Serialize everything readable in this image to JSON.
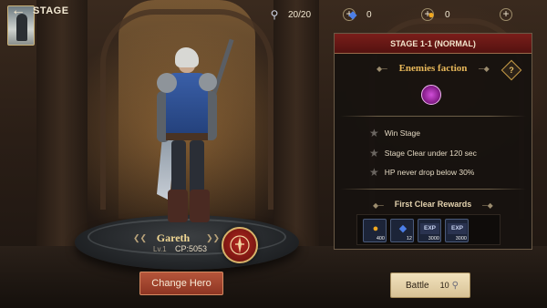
{
  "header": {
    "title": "STAGE",
    "back_icon": "back-arrow-icon"
  },
  "resources": [
    {
      "icon": "key-icon",
      "value": "20/20"
    },
    {
      "icon": "gem-icon",
      "value": "0"
    },
    {
      "icon": "gold-icon",
      "value": "0"
    }
  ],
  "hero": {
    "name": "Gareth",
    "level": "Lv.1",
    "cp": "CP:5053",
    "change_label": "Change Hero"
  },
  "panel": {
    "title": "STAGE 1-1 (NORMAL)",
    "enemies_label": "Enemies faction",
    "help_label": "?",
    "objectives": [
      "Win Stage",
      "Stage Clear under 120 sec",
      "HP never drop below 30%"
    ],
    "rewards_label": "First Clear Rewards",
    "rewards": [
      {
        "icon": "gold-icon",
        "label": "",
        "count": "400"
      },
      {
        "icon": "gem-icon",
        "label": "",
        "count": "12"
      },
      {
        "icon": "exp-icon",
        "label": "EXP",
        "count": "3000"
      },
      {
        "icon": "exp-icon",
        "label": "EXP",
        "count": "3000"
      }
    ]
  },
  "battle": {
    "label": "Battle",
    "cost": "10"
  },
  "colors": {
    "header_red": "#7a1e1a",
    "gold_text": "#e8b85a",
    "change_btn": "#b5553a",
    "battle_btn": "#f2e2bd"
  }
}
